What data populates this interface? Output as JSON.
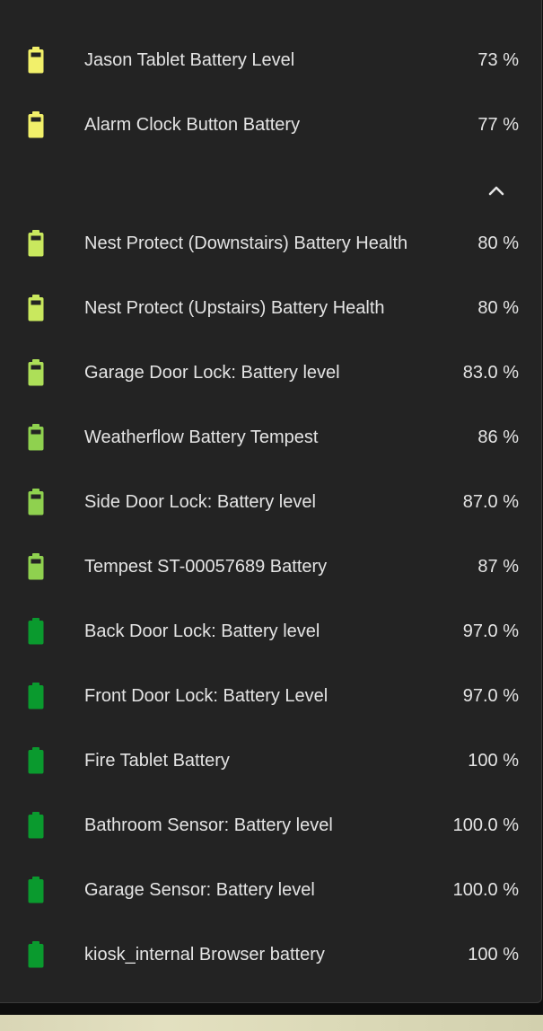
{
  "colors": {
    "card_background": "#232323",
    "text": "#e4e4e4",
    "battery_yellow": "#f2f06a",
    "battery_yellow_green": "#c7e65c",
    "battery_light_green": "#8ccf4e",
    "battery_green": "#0a9a2e"
  },
  "collapse_icon": "chevron-up-icon",
  "batteries": [
    {
      "label": "Jason Tablet Battery Level",
      "value": "73 %",
      "level": 73,
      "color": "#f2f06a"
    },
    {
      "label": "Alarm Clock Button Battery",
      "value": "77 %",
      "level": 77,
      "color": "#f2f06a"
    },
    {
      "label": "Nest Protect (Downstairs) Battery Health",
      "value": "80 %",
      "level": 80,
      "color": "#c9e85e"
    },
    {
      "label": "Nest Protect (Upstairs) Battery Health",
      "value": "80 %",
      "level": 80,
      "color": "#c9e85e"
    },
    {
      "label": "Garage Door Lock: Battery level",
      "value": "83.0 %",
      "level": 83,
      "color": "#addf58"
    },
    {
      "label": "Weatherflow Battery Tempest",
      "value": "86 %",
      "level": 86,
      "color": "#8fd14f"
    },
    {
      "label": "Side Door Lock: Battery level",
      "value": "87.0 %",
      "level": 87,
      "color": "#8fd14f"
    },
    {
      "label": "Tempest ST-00057689 Battery",
      "value": "87 %",
      "level": 87,
      "color": "#8fd14f"
    },
    {
      "label": "Back Door Lock: Battery level",
      "value": "97.0 %",
      "level": 97,
      "color": "#0a9a2e"
    },
    {
      "label": "Front Door Lock: Battery Level",
      "value": "97.0 %",
      "level": 97,
      "color": "#0a9a2e"
    },
    {
      "label": "Fire Tablet Battery",
      "value": "100 %",
      "level": 100,
      "color": "#0a9a2e"
    },
    {
      "label": "Bathroom Sensor: Battery level",
      "value": "100.0 %",
      "level": 100,
      "color": "#0a9a2e"
    },
    {
      "label": "Garage Sensor: Battery level",
      "value": "100.0 %",
      "level": 100,
      "color": "#0a9a2e"
    },
    {
      "label": "kiosk_internal Browser battery",
      "value": "100 %",
      "level": 100,
      "color": "#0a9a2e"
    }
  ]
}
